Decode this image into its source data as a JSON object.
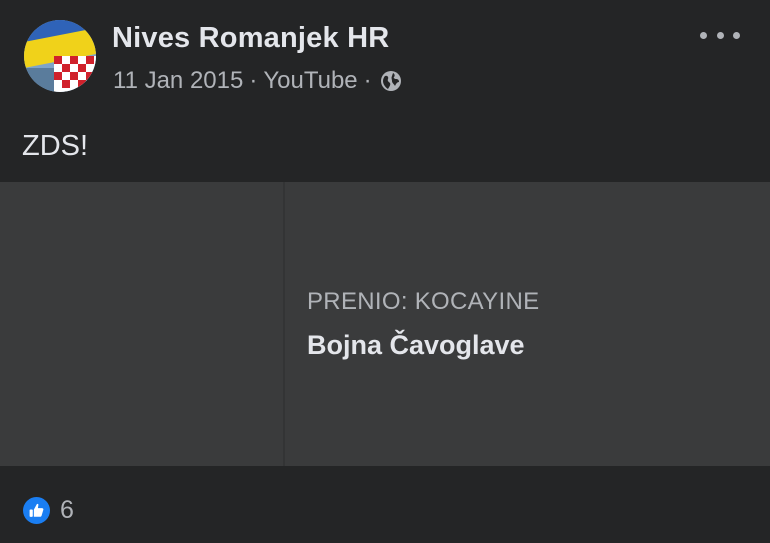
{
  "post": {
    "author": "Nives Romanjek HR",
    "date": "11 Jan 2015",
    "separator": "·",
    "source": "YouTube",
    "privacy_icon": "globe-icon",
    "more_icon": "more-options-icon",
    "text": "ZDS!",
    "link": {
      "domain": "PRENIO: KOCAYINE",
      "title": "Bojna Čavoglave"
    },
    "reactions": {
      "icon": "like-icon",
      "count": "6"
    }
  }
}
